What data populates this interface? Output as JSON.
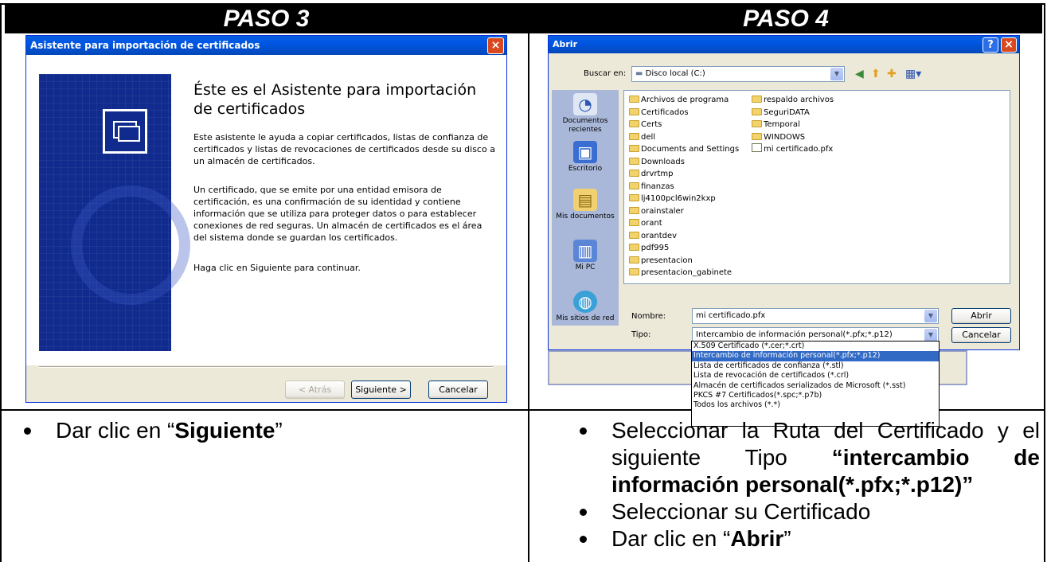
{
  "headers": {
    "left": "PASO 3",
    "right": "PASO 4"
  },
  "wizard": {
    "title": "Asistente para importación de certificados",
    "close": "×",
    "heading": "Éste es el Asistente para importación de certificados",
    "para1": "Este asistente le ayuda a copiar certificados, listas de confianza de certificados y listas de revocaciones de certificados desde su disco a un almacén de certificados.",
    "para2": "Un certificado, que se emite por una entidad emisora de certificación, es una confirmación de su identidad y contiene información que se utiliza para proteger datos o para establecer conexiones de red seguras. Un almacén de certificados es el área del sistema donde se guardan los certificados.",
    "para3": "Haga clic en Siguiente para continuar.",
    "back_label": "< Atrás",
    "next_label": "Siguiente >",
    "cancel_label": "Cancelar"
  },
  "open_dialog": {
    "title": "Abrir",
    "help": "?",
    "close": "×",
    "look_in_label": "Buscar en:",
    "look_in_value": "Disco local (C:)",
    "places": [
      "Documentos recientes",
      "Escritorio",
      "Mis documentos",
      "Mi PC",
      "Mis sitios de red"
    ],
    "files_col1": [
      "Archivos de programa",
      "Certificados",
      "Certs",
      "dell",
      "Documents and Settings",
      "Downloads",
      "drvrtmp",
      "finanzas",
      "lj4100pcl6win2kxp",
      "orainstaler",
      "orant",
      "orantdev",
      "pdf995",
      "presentacion",
      "presentacion_gabinete"
    ],
    "files_col2": [
      "respaldo archivos",
      "SeguriDATA",
      "Temporal",
      "WINDOWS",
      "mi certificado.pfx"
    ],
    "name_label": "Nombre:",
    "name_value": "mi certificado.pfx",
    "type_label": "Tipo:",
    "type_value": "Intercambio de información personal(*.pfx;*.p12)",
    "open_label": "Abrir",
    "cancel_label": "Cancelar",
    "type_options": [
      "X.509 Certificado (*.cer;*.crt)",
      "Intercambio de información personal(*.pfx;*.p12)",
      "Lista de certificados de confianza (*.stl)",
      "Lista de revocación de certificados (*.crl)",
      "Almacén de certificados serializados de Microsoft (*.sst)",
      "PKCS #7 Certificados(*.spc;*.p7b)",
      "Todos los archivos (*.*)"
    ],
    "selected_option_index": 1
  },
  "instructions": {
    "left": {
      "prefix": "Dar clic en “",
      "bold": "Siguiente",
      "suffix": "”"
    },
    "right": {
      "item1_text": "Seleccionar la Ruta del Certificado y el siguiente Tipo ",
      "item1_bold": "“intercambio de información personal(*.pfx;*.p12)”",
      "item2": "Seleccionar su Certificado",
      "item3_prefix": "Dar clic en “",
      "item3_bold": "Abrir",
      "item3_suffix": "”"
    }
  }
}
